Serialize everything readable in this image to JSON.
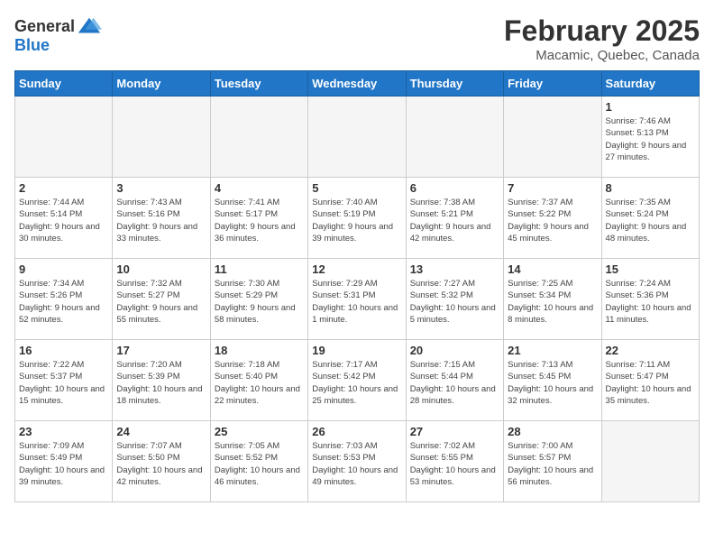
{
  "header": {
    "logo_line1": "General",
    "logo_line2": "Blue",
    "title": "February 2025",
    "subtitle": "Macamic, Quebec, Canada"
  },
  "weekdays": [
    "Sunday",
    "Monday",
    "Tuesday",
    "Wednesday",
    "Thursday",
    "Friday",
    "Saturday"
  ],
  "weeks": [
    [
      {
        "day": "",
        "info": ""
      },
      {
        "day": "",
        "info": ""
      },
      {
        "day": "",
        "info": ""
      },
      {
        "day": "",
        "info": ""
      },
      {
        "day": "",
        "info": ""
      },
      {
        "day": "",
        "info": ""
      },
      {
        "day": "1",
        "info": "Sunrise: 7:46 AM\nSunset: 5:13 PM\nDaylight: 9 hours and 27 minutes."
      }
    ],
    [
      {
        "day": "2",
        "info": "Sunrise: 7:44 AM\nSunset: 5:14 PM\nDaylight: 9 hours and 30 minutes."
      },
      {
        "day": "3",
        "info": "Sunrise: 7:43 AM\nSunset: 5:16 PM\nDaylight: 9 hours and 33 minutes."
      },
      {
        "day": "4",
        "info": "Sunrise: 7:41 AM\nSunset: 5:17 PM\nDaylight: 9 hours and 36 minutes."
      },
      {
        "day": "5",
        "info": "Sunrise: 7:40 AM\nSunset: 5:19 PM\nDaylight: 9 hours and 39 minutes."
      },
      {
        "day": "6",
        "info": "Sunrise: 7:38 AM\nSunset: 5:21 PM\nDaylight: 9 hours and 42 minutes."
      },
      {
        "day": "7",
        "info": "Sunrise: 7:37 AM\nSunset: 5:22 PM\nDaylight: 9 hours and 45 minutes."
      },
      {
        "day": "8",
        "info": "Sunrise: 7:35 AM\nSunset: 5:24 PM\nDaylight: 9 hours and 48 minutes."
      }
    ],
    [
      {
        "day": "9",
        "info": "Sunrise: 7:34 AM\nSunset: 5:26 PM\nDaylight: 9 hours and 52 minutes."
      },
      {
        "day": "10",
        "info": "Sunrise: 7:32 AM\nSunset: 5:27 PM\nDaylight: 9 hours and 55 minutes."
      },
      {
        "day": "11",
        "info": "Sunrise: 7:30 AM\nSunset: 5:29 PM\nDaylight: 9 hours and 58 minutes."
      },
      {
        "day": "12",
        "info": "Sunrise: 7:29 AM\nSunset: 5:31 PM\nDaylight: 10 hours and 1 minute."
      },
      {
        "day": "13",
        "info": "Sunrise: 7:27 AM\nSunset: 5:32 PM\nDaylight: 10 hours and 5 minutes."
      },
      {
        "day": "14",
        "info": "Sunrise: 7:25 AM\nSunset: 5:34 PM\nDaylight: 10 hours and 8 minutes."
      },
      {
        "day": "15",
        "info": "Sunrise: 7:24 AM\nSunset: 5:36 PM\nDaylight: 10 hours and 11 minutes."
      }
    ],
    [
      {
        "day": "16",
        "info": "Sunrise: 7:22 AM\nSunset: 5:37 PM\nDaylight: 10 hours and 15 minutes."
      },
      {
        "day": "17",
        "info": "Sunrise: 7:20 AM\nSunset: 5:39 PM\nDaylight: 10 hours and 18 minutes."
      },
      {
        "day": "18",
        "info": "Sunrise: 7:18 AM\nSunset: 5:40 PM\nDaylight: 10 hours and 22 minutes."
      },
      {
        "day": "19",
        "info": "Sunrise: 7:17 AM\nSunset: 5:42 PM\nDaylight: 10 hours and 25 minutes."
      },
      {
        "day": "20",
        "info": "Sunrise: 7:15 AM\nSunset: 5:44 PM\nDaylight: 10 hours and 28 minutes."
      },
      {
        "day": "21",
        "info": "Sunrise: 7:13 AM\nSunset: 5:45 PM\nDaylight: 10 hours and 32 minutes."
      },
      {
        "day": "22",
        "info": "Sunrise: 7:11 AM\nSunset: 5:47 PM\nDaylight: 10 hours and 35 minutes."
      }
    ],
    [
      {
        "day": "23",
        "info": "Sunrise: 7:09 AM\nSunset: 5:49 PM\nDaylight: 10 hours and 39 minutes."
      },
      {
        "day": "24",
        "info": "Sunrise: 7:07 AM\nSunset: 5:50 PM\nDaylight: 10 hours and 42 minutes."
      },
      {
        "day": "25",
        "info": "Sunrise: 7:05 AM\nSunset: 5:52 PM\nDaylight: 10 hours and 46 minutes."
      },
      {
        "day": "26",
        "info": "Sunrise: 7:03 AM\nSunset: 5:53 PM\nDaylight: 10 hours and 49 minutes."
      },
      {
        "day": "27",
        "info": "Sunrise: 7:02 AM\nSunset: 5:55 PM\nDaylight: 10 hours and 53 minutes."
      },
      {
        "day": "28",
        "info": "Sunrise: 7:00 AM\nSunset: 5:57 PM\nDaylight: 10 hours and 56 minutes."
      },
      {
        "day": "",
        "info": ""
      }
    ]
  ]
}
